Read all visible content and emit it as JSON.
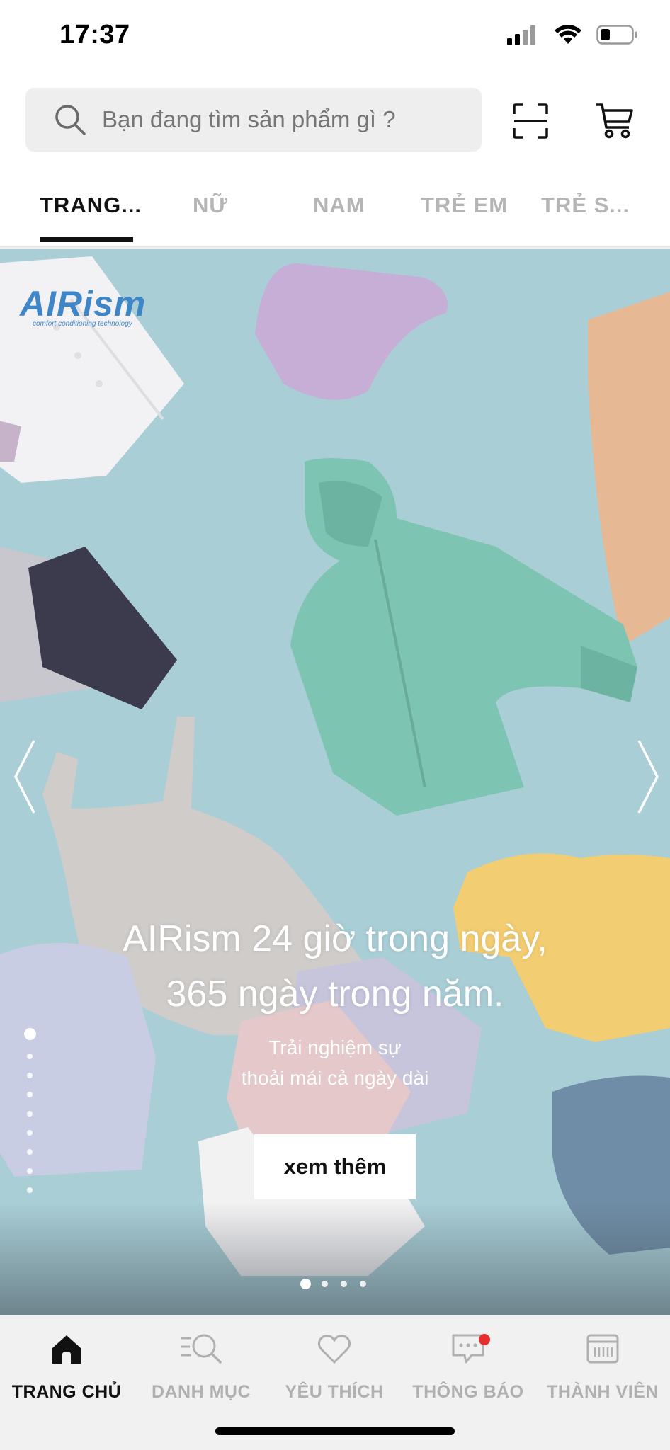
{
  "status_bar": {
    "time": "17:37"
  },
  "search": {
    "placeholder": "Bạn đang tìm sản phẩm gì ?"
  },
  "tabs": [
    {
      "label": "TRANG..."
    },
    {
      "label": "NỮ"
    },
    {
      "label": "NAM"
    },
    {
      "label": "TRẺ EM"
    },
    {
      "label": "TRẺ S..."
    }
  ],
  "hero": {
    "brand_logo": "AIRism",
    "brand_tagline": "comfort conditioning technology",
    "headline_line1": "AIRism 24 giờ trong ngày,",
    "headline_line2": "365 ngày trong năm.",
    "subtext_line1": "Trải nghiệm sự",
    "subtext_line2": "thoải mái cả ngày dài",
    "cta_label": "xem thêm",
    "vertical_page_count": 9,
    "vertical_page_active": 1,
    "horizontal_page_count": 4,
    "horizontal_page_active": 1
  },
  "bottom_nav": [
    {
      "label": "TRANG CHỦ",
      "icon": "home-icon"
    },
    {
      "label": "DANH MỤC",
      "icon": "category-search-icon"
    },
    {
      "label": "YÊU THÍCH",
      "icon": "heart-icon"
    },
    {
      "label": "THÔNG BÁO",
      "icon": "chat-bubble-icon",
      "has_badge": true
    },
    {
      "label": "THÀNH VIÊN",
      "icon": "member-card-icon"
    }
  ],
  "colors": {
    "hero_background": "#a8cdd5",
    "notification_badge": "#e52f2f",
    "airism_blue": "#3f86c9"
  }
}
